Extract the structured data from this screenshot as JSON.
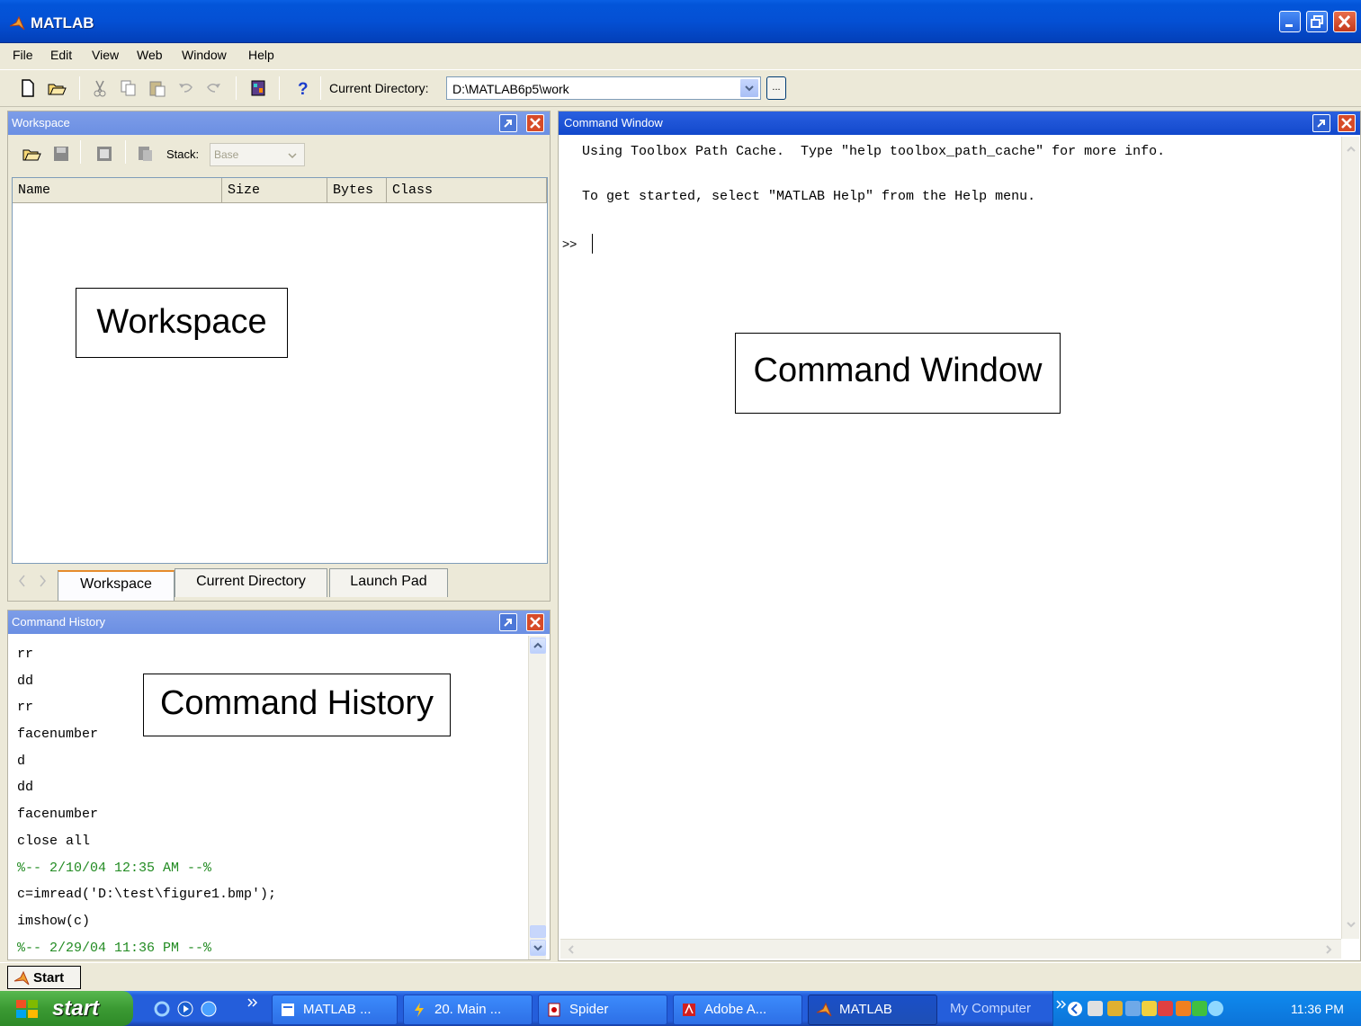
{
  "window": {
    "title": "MATLAB"
  },
  "menu": [
    "File",
    "Edit",
    "View",
    "Web",
    "Window",
    "Help"
  ],
  "toolbar": {
    "current_directory_label": "Current Directory:",
    "current_directory": "D:\\MATLAB6p5\\work",
    "browse_label": "..."
  },
  "workspace": {
    "title": "Workspace",
    "stack_label": "Stack:",
    "stack_value": "Base",
    "columns": [
      "Name",
      "Size",
      "Bytes",
      "Class"
    ],
    "tabs": [
      "Workspace",
      "Current Directory",
      "Launch Pad"
    ],
    "callout": "Workspace"
  },
  "command_history": {
    "title": "Command History",
    "callout": "Command History",
    "lines": [
      {
        "text": "rr",
        "sep": false
      },
      {
        "text": "dd",
        "sep": false
      },
      {
        "text": "rr",
        "sep": false
      },
      {
        "text": "facenumber",
        "sep": false
      },
      {
        "text": "d",
        "sep": false
      },
      {
        "text": "dd",
        "sep": false
      },
      {
        "text": "facenumber",
        "sep": false
      },
      {
        "text": "close all",
        "sep": false
      },
      {
        "text": "%-- 2/10/04 12:35 AM --%",
        "sep": true
      },
      {
        "text": "c=imread('D:\\test\\figure1.bmp');",
        "sep": false
      },
      {
        "text": "imshow(c)",
        "sep": false
      },
      {
        "text": "%-- 2/29/04 11:36 PM --%",
        "sep": true
      }
    ]
  },
  "command_window": {
    "title": "Command Window",
    "line1": "Using Toolbox Path Cache.  Type \"help toolbox_path_cache\" for more info.",
    "line2": "To get started, select \"MATLAB Help\" from the Help menu.",
    "prompt": ">>",
    "callout": "Command Window"
  },
  "matlab_startbar": {
    "start_label": "Start"
  },
  "taskbar": {
    "start_label": "start",
    "buttons": [
      "MATLAB ...",
      "20. Main ...",
      "Spider",
      "Adobe A...",
      "MATLAB"
    ],
    "tray_label": "My Computer",
    "time": "11:36 PM"
  },
  "colors": {
    "title_bar": "#0450d4",
    "panel_header_active": "#1248cc",
    "panel_header_inactive": "#7d9de8",
    "history_separator": "#228b22",
    "taskbar": "#245edb"
  }
}
